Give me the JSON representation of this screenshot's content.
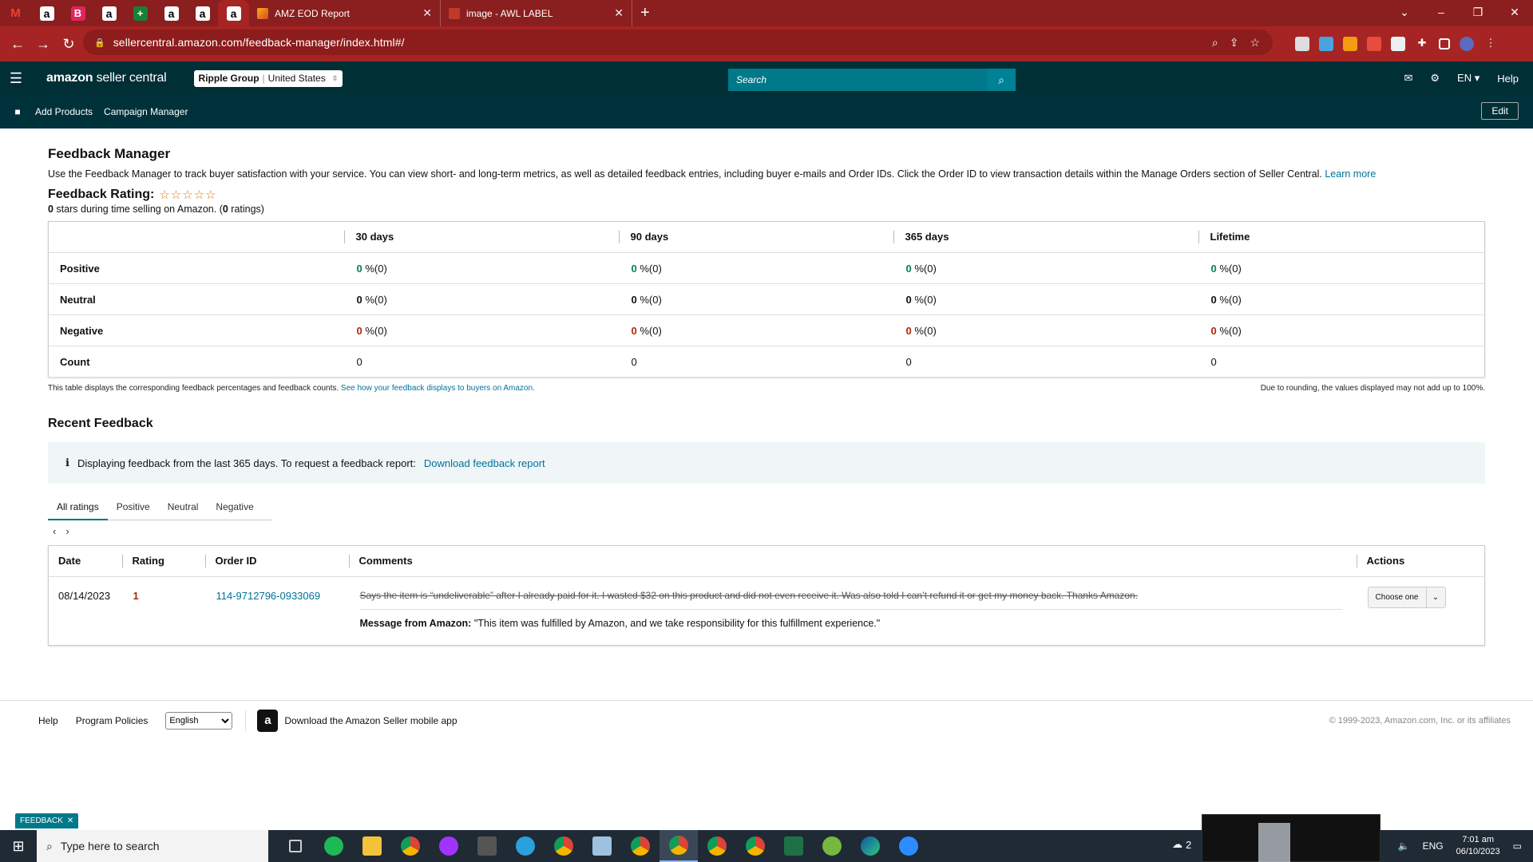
{
  "browser": {
    "tabs": [
      {
        "title": "AMZ EOD Report",
        "icon_color": "#f4b400"
      },
      {
        "title": "image - AWL LABEL",
        "icon_color": "#ffffff"
      }
    ],
    "url": "sellercentral.amazon.com/feedback-manager/index.html#/"
  },
  "header": {
    "logo_bold": "amazon",
    "logo_rest": " seller central",
    "account_name": "Ripple Group",
    "account_market": "United States",
    "search_placeholder": "Search",
    "language": "EN",
    "help": "Help"
  },
  "subnav": {
    "links": [
      "Add Products",
      "Campaign Manager"
    ],
    "edit": "Edit"
  },
  "page": {
    "title": "Feedback Manager",
    "description": "Use the Feedback Manager to track buyer satisfaction with your service. You can view short- and long-term metrics, as well as detailed feedback entries, including buyer e-mails and Order IDs. Click the Order ID to view transaction details within the Manage Orders section of Seller Central.",
    "learn_more": "Learn more",
    "rating_label": "Feedback Rating:",
    "stars": "☆☆☆☆☆",
    "rating_value": "0",
    "rating_sub_a": " stars during time selling on Amazon. (",
    "rating_count": "0",
    "rating_sub_b": " ratings)"
  },
  "metrics": {
    "columns": [
      "30 days",
      "90 days",
      "365 days",
      "Lifetime"
    ],
    "rows": [
      {
        "label": "Positive",
        "values": [
          "0",
          "0",
          "0",
          "0"
        ],
        "suffix": " %(0)"
      },
      {
        "label": "Neutral",
        "values": [
          "0",
          "0",
          "0",
          "0"
        ],
        "suffix": " %(0)"
      },
      {
        "label": "Negative",
        "values": [
          "0",
          "0",
          "0",
          "0"
        ],
        "suffix": " %(0)"
      },
      {
        "label": "Count",
        "values": [
          "0",
          "0",
          "0",
          "0"
        ],
        "suffix": ""
      }
    ],
    "note_left": "This table displays the corresponding feedback percentages and feedback counts.",
    "note_link": "See how your feedback displays to buyers on Amazon.",
    "note_right": "Due to rounding, the values displayed may not add up to 100%."
  },
  "recent": {
    "title": "Recent Feedback",
    "info_icon": "i",
    "info_text": "Displaying feedback from the last 365 days. To request a feedback report:",
    "info_link": "Download feedback report",
    "tabs": [
      "All ratings",
      "Positive",
      "Neutral",
      "Negative"
    ],
    "pager_prev": "‹",
    "pager_next": "›",
    "columns": [
      "Date",
      "Rating",
      "Order ID",
      "Comments",
      "Actions"
    ],
    "rows": [
      {
        "date": "08/14/2023",
        "rating": "1",
        "order_id": "114-9712796-0933069",
        "comment": "Says the item is “undeliverable” after I already paid for it. I wasted $32 on this product and did not even receive it. Was also told I can’t refund it or get my money back. Thanks Amazon.",
        "message_label": "Message from Amazon:",
        "message": " \"This item was fulfilled by Amazon, and we take responsibility for this fulfillment experience.\"",
        "action": "Choose one"
      }
    ]
  },
  "footer": {
    "help": "Help",
    "policies": "Program Policies",
    "language": "English",
    "app": "Download the Amazon Seller mobile app",
    "copyright": "© 1999-2023, Amazon.com, Inc. or its affiliates"
  },
  "feedback_tab": "FEEDBACK",
  "taskbar": {
    "search": "Type here to search",
    "weather": "2",
    "lang": "ENG",
    "time": "7:01 am",
    "date": "06/10/2023"
  },
  "colors": {
    "browser_frame": "#8b1e1e",
    "header_bg": "#002f36",
    "accent_teal": "#008296",
    "positive": "#067d62",
    "negative": "#b12704"
  }
}
